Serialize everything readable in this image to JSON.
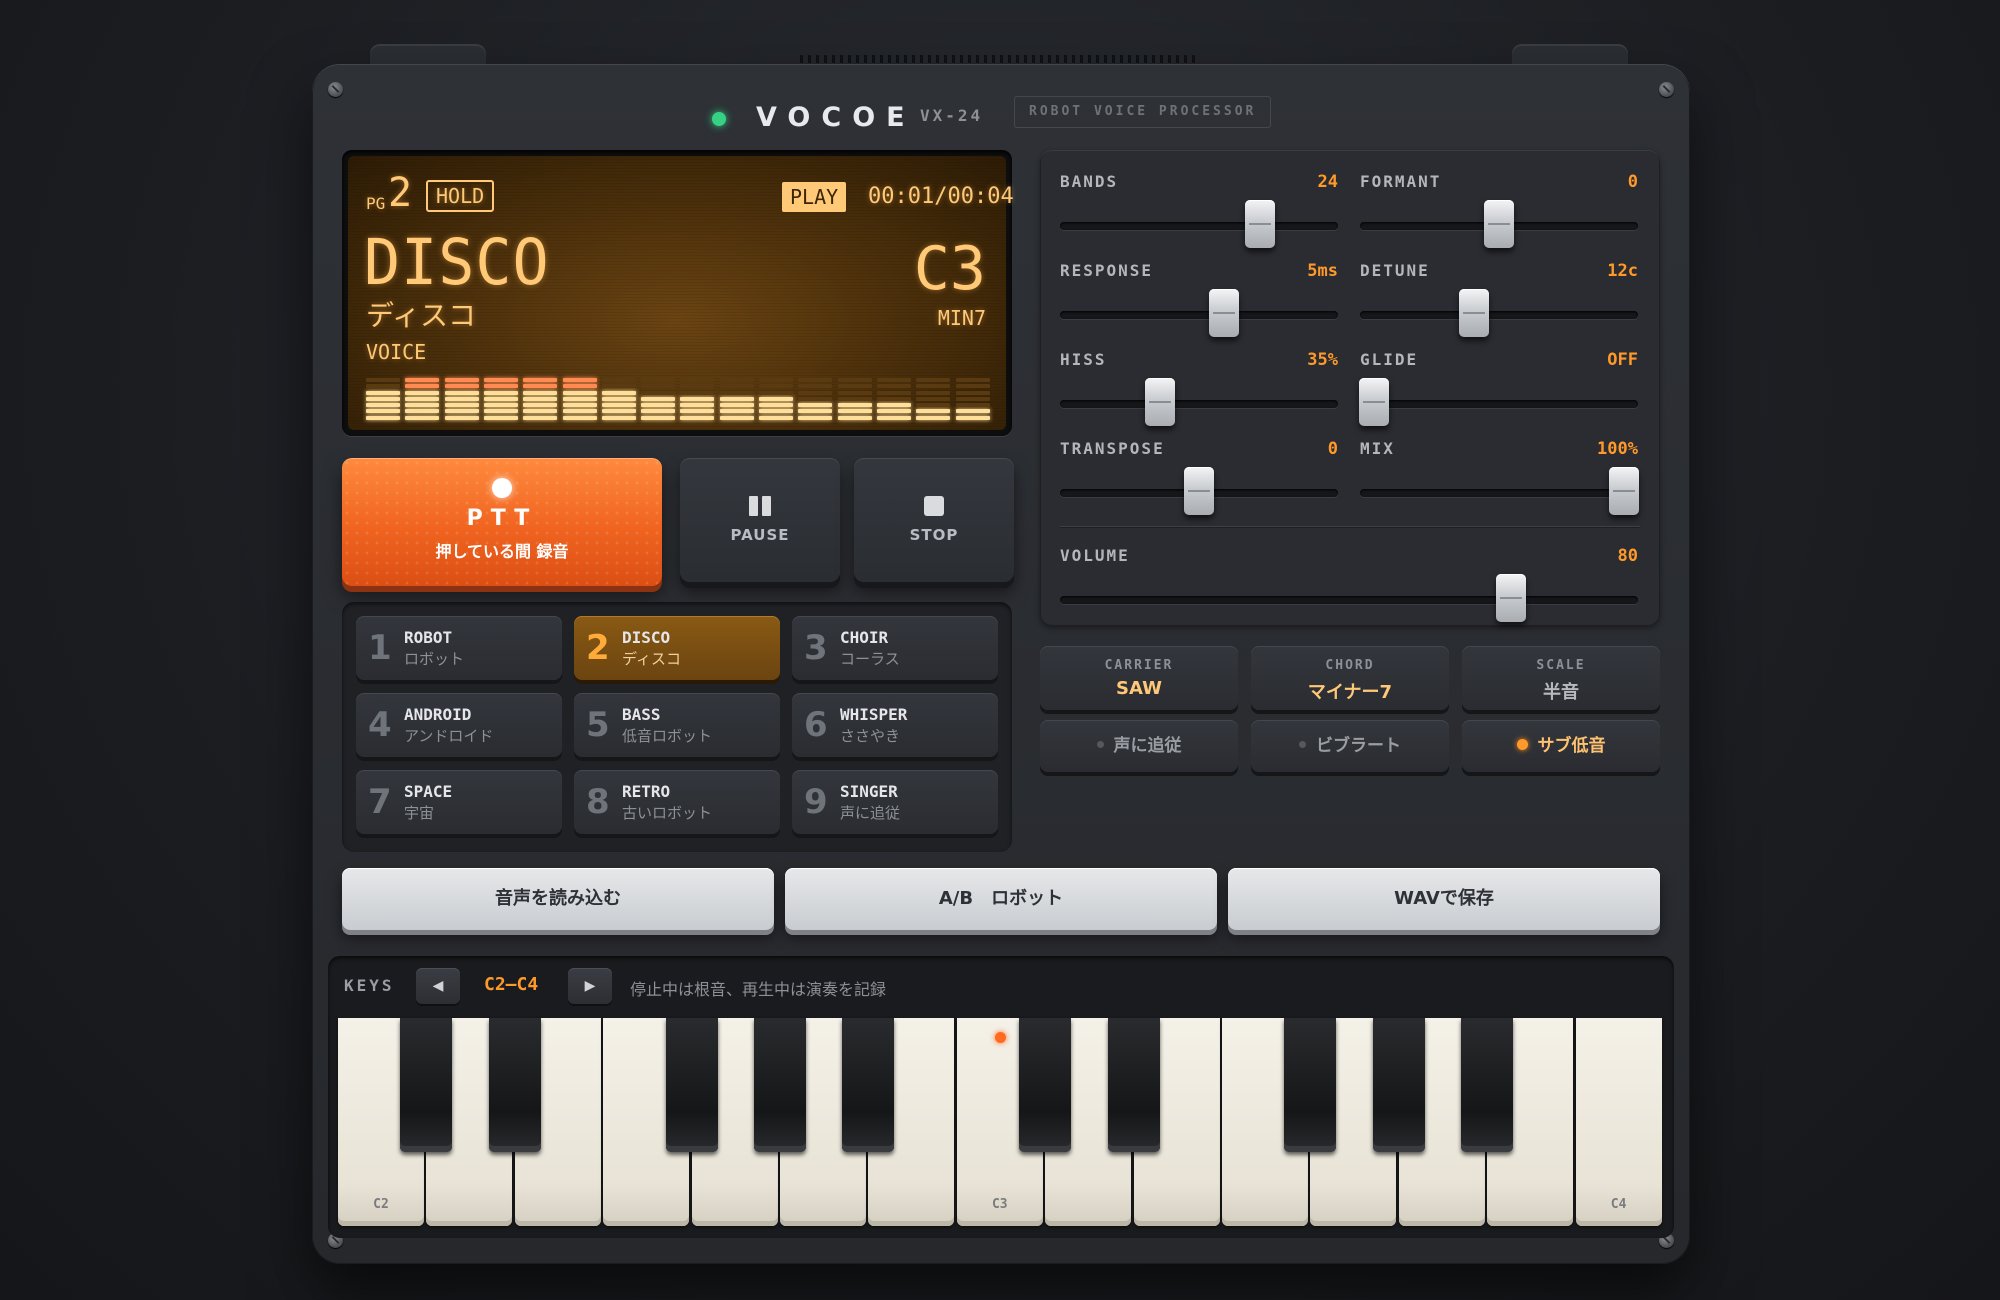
{
  "header": {
    "brand": "VOCOE",
    "model": "VX-24",
    "subtitle": "ROBOT VOICE PROCESSOR"
  },
  "lcd": {
    "pg_label": "PG",
    "pg_number": "2",
    "hold": "HOLD",
    "play": "PLAY",
    "time": "00:01/00:04",
    "voice_name": "DISCO",
    "voice_jp": "ディスコ",
    "voice_label": "VOICE",
    "note": "C3",
    "chord": "MIN7",
    "meter_levels": [
      5,
      7,
      7,
      7,
      7,
      7,
      5,
      4,
      4,
      4,
      4,
      3,
      3,
      3,
      2,
      2
    ],
    "meter_colors": {
      "low": "#ffdf9a",
      "high": "#ff8a52",
      "off": "#5a3a10"
    }
  },
  "transport": {
    "ptt_label": "PTT",
    "ptt_sub": "押している間 録音",
    "pause_label": "PAUSE",
    "stop_label": "STOP"
  },
  "presets": [
    {
      "num": "1",
      "en": "ROBOT",
      "jp": "ロボット",
      "active": false
    },
    {
      "num": "2",
      "en": "DISCO",
      "jp": "ディスコ",
      "active": true
    },
    {
      "num": "3",
      "en": "CHOIR",
      "jp": "コーラス",
      "active": false
    },
    {
      "num": "4",
      "en": "ANDROID",
      "jp": "アンドロイド",
      "active": false
    },
    {
      "num": "5",
      "en": "BASS",
      "jp": "低音ロボット",
      "active": false
    },
    {
      "num": "6",
      "en": "WHISPER",
      "jp": "ささやき",
      "active": false
    },
    {
      "num": "7",
      "en": "SPACE",
      "jp": "宇宙",
      "active": false
    },
    {
      "num": "8",
      "en": "RETRO",
      "jp": "古いロボット",
      "active": false
    },
    {
      "num": "9",
      "en": "SINGER",
      "jp": "声に追従",
      "active": false
    }
  ],
  "sliders": [
    {
      "name": "BANDS",
      "value": "24",
      "level": 0.72
    },
    {
      "name": "FORMANT",
      "value": "0",
      "level": 0.5
    },
    {
      "name": "RESPONSE",
      "value": "5ms",
      "level": 0.59
    },
    {
      "name": "DETUNE",
      "value": "12c",
      "level": 0.41
    },
    {
      "name": "HISS",
      "value": "35%",
      "level": 0.36
    },
    {
      "name": "GLIDE",
      "value": "OFF",
      "level": 0.05
    },
    {
      "name": "TRANSPOSE",
      "value": "0",
      "level": 0.5
    },
    {
      "name": "MIX",
      "value": "100%",
      "level": 0.95
    }
  ],
  "volume": {
    "name": "VOLUME",
    "value": "80",
    "level": 0.78
  },
  "modes": [
    {
      "key": "CARRIER",
      "value": "SAW",
      "highlight": true
    },
    {
      "key": "CHORD",
      "value": "マイナー7",
      "highlight": true
    },
    {
      "key": "SCALE",
      "value": "半音",
      "highlight": false
    }
  ],
  "toggles": [
    {
      "label": "声に追従",
      "on": false
    },
    {
      "label": "ビブラート",
      "on": false
    },
    {
      "label": "サブ低音",
      "on": true
    }
  ],
  "actions": {
    "load": "音声を読み込む",
    "ab": "A/B　ロボット",
    "save": "WAVで保存"
  },
  "keys": {
    "label": "KEYS",
    "prev": "◀",
    "next": "▶",
    "range": "C2–C4",
    "hint": "停止中は根音、再生中は演奏を記録",
    "octave_labels": [
      "C2",
      "C3",
      "C4"
    ],
    "root_note": "C3"
  }
}
